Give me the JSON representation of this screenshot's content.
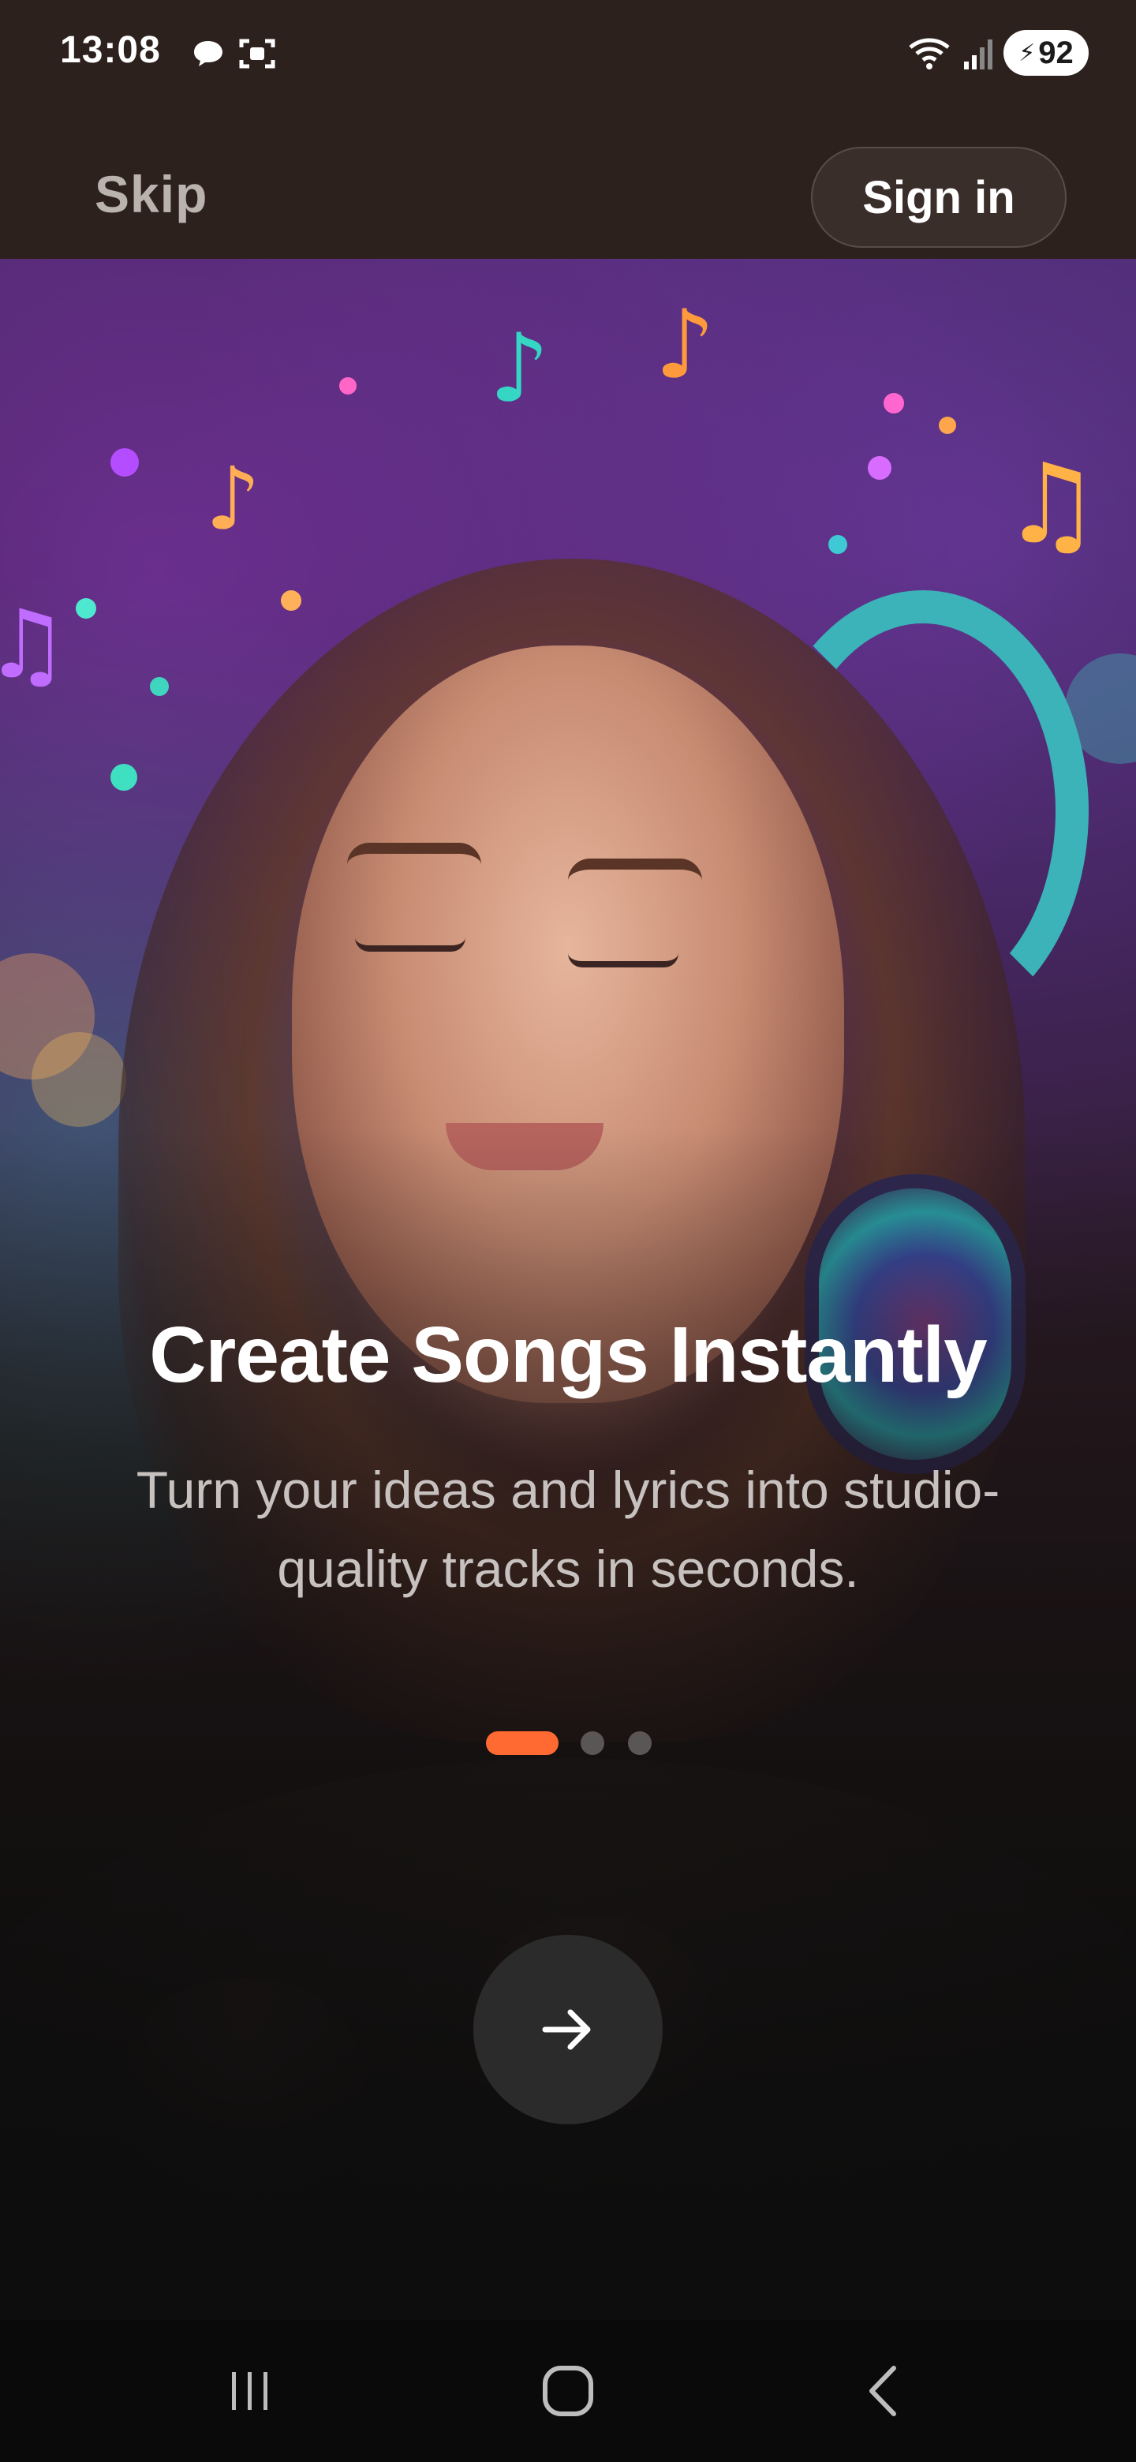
{
  "status_bar": {
    "time": "13:08",
    "battery": "92",
    "icons": [
      "chat-bubble-icon",
      "screenshot-icon",
      "wifi-icon",
      "signal-icon",
      "battery-icon"
    ]
  },
  "header": {
    "skip_label": "Skip",
    "sign_in_label": "Sign in"
  },
  "onboarding": {
    "title": "Create Songs Instantly",
    "subtitle": "Turn your ideas and lyrics into studio-quality tracks in seconds.",
    "page_count": 3,
    "current_page": 1,
    "accent_color": "#ff6a33",
    "next_icon": "arrow-right-icon"
  },
  "nav_bar": {
    "icons": [
      "recent-apps-icon",
      "home-icon",
      "back-icon"
    ]
  }
}
